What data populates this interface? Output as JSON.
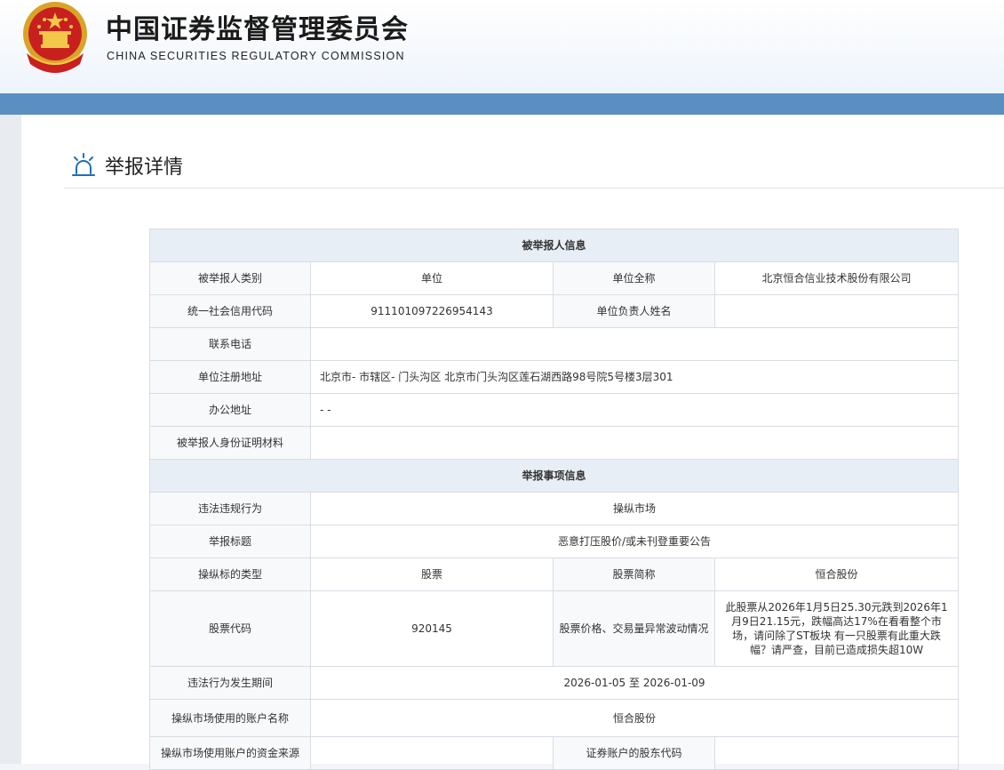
{
  "header": {
    "title_cn": "中国证券监督管理委员会",
    "title_en": "CHINA SECURITIES REGULATORY COMMISSION"
  },
  "page_title": "举报详情",
  "sections": {
    "reported": "被举报人信息",
    "matter": "举报事项信息"
  },
  "reported": {
    "type_label": "被举报人类别",
    "type_value": "单位",
    "fullname_label": "单位全称",
    "fullname_value": "北京恒合信业技术股份有限公司",
    "credit_label": "统一社会信用代码",
    "credit_value": "911101097226954143",
    "leader_label": "单位负责人姓名",
    "leader_value": "",
    "phone_label": "联系电话",
    "phone_value": "",
    "reg_addr_label": "单位注册地址",
    "reg_addr_value": "北京市- 市辖区- 门头沟区 北京市门头沟区莲石湖西路98号院5号楼3层301",
    "office_label": "办公地址",
    "office_value": "- -",
    "id_label": "被举报人身份证明材料",
    "id_value": ""
  },
  "matter": {
    "violation_label": "违法违规行为",
    "violation_value": "操纵市场",
    "subject_label": "举报标题",
    "subject_value": "恶意打压股价/或未刊登重要公告",
    "target_type_label": "操纵标的类型",
    "target_type_value": "股票",
    "stock_short_label": "股票简称",
    "stock_short_value": "恒合股份",
    "stock_code_label": "股票代码",
    "stock_code_value": "920145",
    "abnormal_label": "股票价格、交易量异常波动情况",
    "abnormal_value": "此股票从2026年1月5日25.30元跌到2026年1月9日21.15元，跌幅高达17%在看看整个市场，请问除了ST板块 有一只股票有此重大跌幅？请严查，目前已造成损失超10W",
    "period_label": "违法行为发生期间",
    "period_value": "2026-01-05 至 2026-01-09",
    "account_name_label": "操纵市场使用的账户名称",
    "account_name_value": "恒合股份",
    "fund_source_label": "操纵市场使用账户的资金来源",
    "fund_source_value": "",
    "holder_code_label": "证券账户的股东代码",
    "holder_code_value": ""
  },
  "colors": {
    "blue_bar": "#5b8fc1",
    "section_bg": "#e8eef5",
    "icon_blue": "#1f6fb5"
  },
  "icons": {
    "emblem": "national-emblem-icon",
    "report": "alarm-light-icon"
  }
}
